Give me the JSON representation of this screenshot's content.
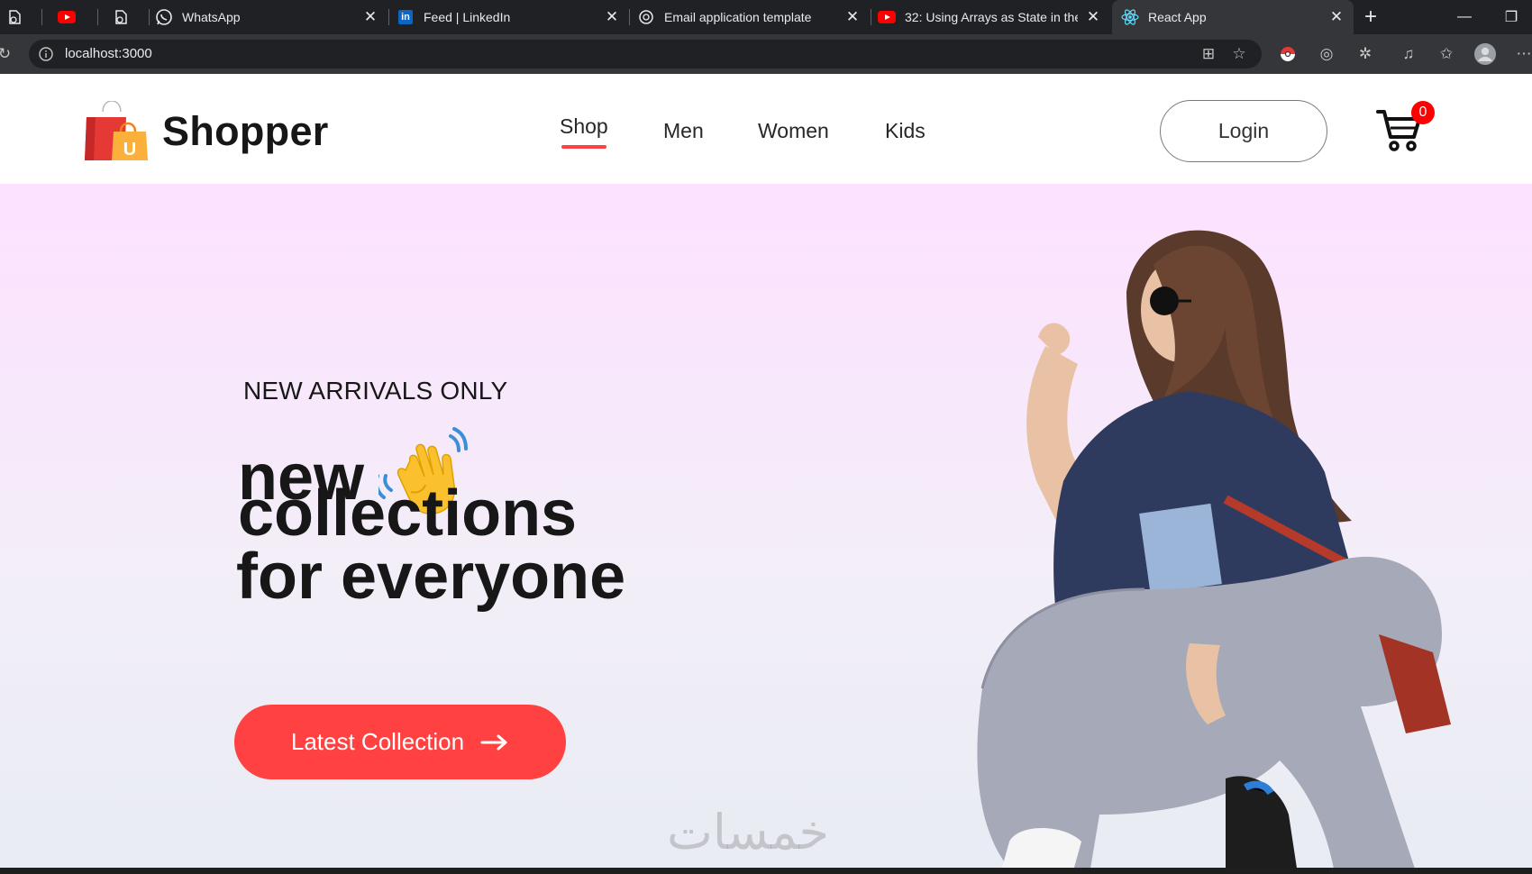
{
  "browser": {
    "tabs": [
      {
        "title": "",
        "icon": "file-icon"
      },
      {
        "title": "",
        "icon": "youtube-icon"
      },
      {
        "title": "",
        "icon": "file-icon"
      },
      {
        "title": "WhatsApp",
        "icon": "whatsapp-icon"
      },
      {
        "title": "Feed | LinkedIn",
        "icon": "linkedin-icon"
      },
      {
        "title": "Email application template",
        "icon": "chatgpt-icon"
      },
      {
        "title": "32: Using Arrays as State in the",
        "icon": "youtube-icon"
      },
      {
        "title": "React App",
        "icon": "react-icon",
        "active": true
      }
    ],
    "new_tab": "+",
    "url": "localhost:3000"
  },
  "navbar": {
    "logo_text": "Shopper",
    "logo_letter": "U",
    "menu": [
      "Shop",
      "Men",
      "Women",
      "Kids"
    ],
    "active_menu": "Shop",
    "login_label": "Login",
    "cart_count": "0"
  },
  "hero": {
    "tag": "NEW ARRIVALS ONLY",
    "line1": "new",
    "line2": "collections",
    "line3": "for everyone",
    "cta_label": "Latest Collection"
  },
  "watermark": "خمسات",
  "colors": {
    "accent": "#ff4141",
    "hero_top": "#fde1ff",
    "text_dark": "#171717"
  }
}
